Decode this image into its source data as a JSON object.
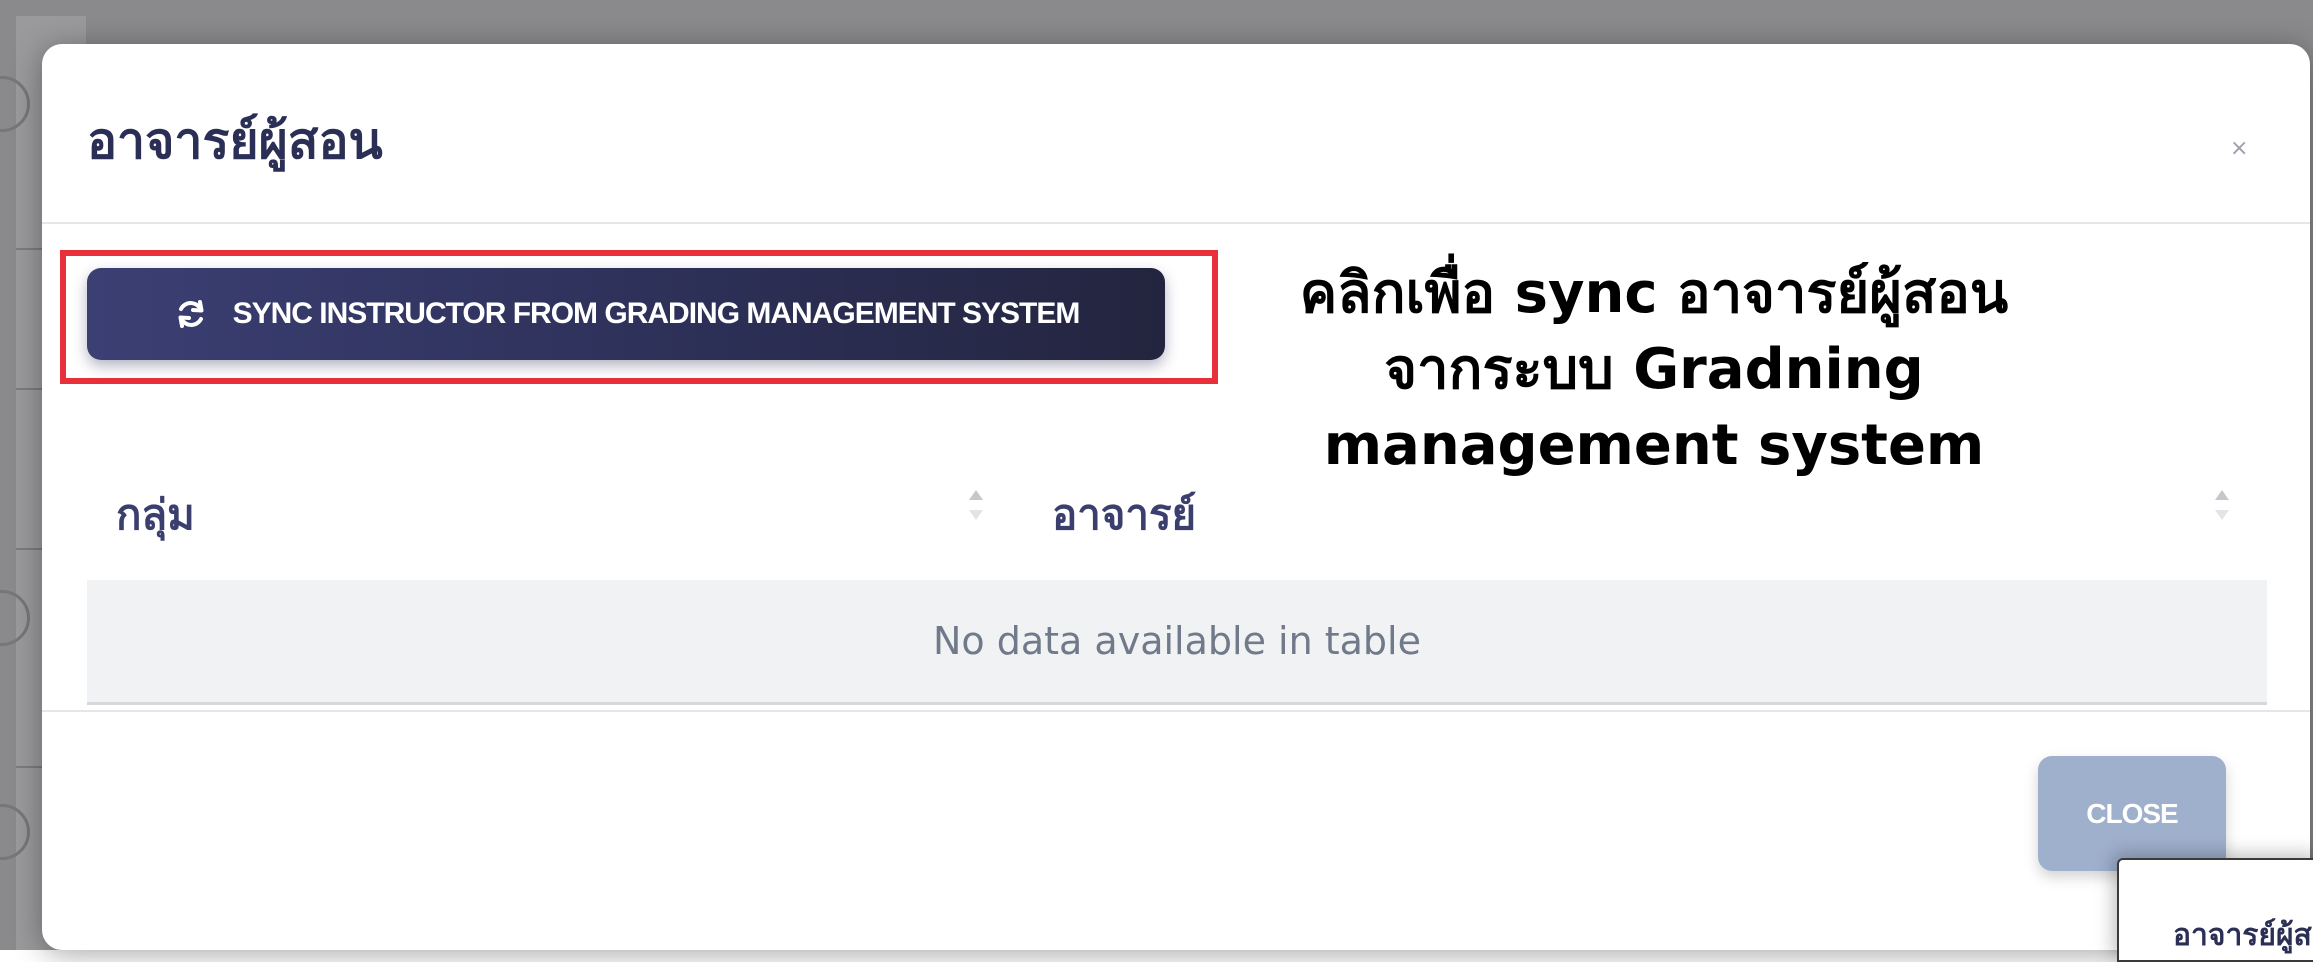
{
  "modal": {
    "title": "อาจารย์ผู้สอน",
    "close_x": "×"
  },
  "sync_button": {
    "label": "SYNC INSTRUCTOR FROM GRADING MANAGEMENT SYSTEM",
    "icon": "sync-icon"
  },
  "annotation": {
    "lines": [
      "คลิกเพื่อ sync อาจารย์ผู้สอน",
      "จากระบบ Gradning",
      "management system"
    ]
  },
  "table": {
    "columns": [
      "กลุ่ม",
      "อาจารย์"
    ],
    "empty_message": "No data available in table"
  },
  "footer": {
    "close_label": "CLOSE"
  },
  "preview": {
    "title": "อาจารย์ผู้ส"
  },
  "colors": {
    "sync_button": "#2c2f55",
    "close_button": "#9fb0cd",
    "highlight_border": "#e8303a",
    "title_text": "#2b2f55"
  }
}
